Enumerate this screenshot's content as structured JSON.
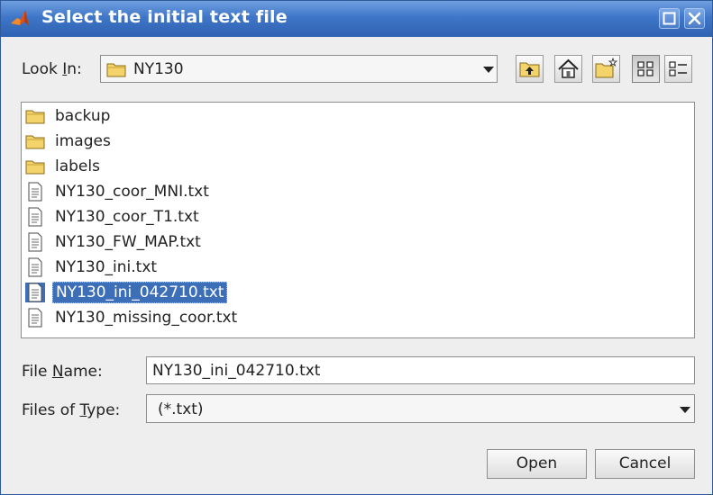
{
  "window": {
    "title": "Select the initial text file"
  },
  "look_in": {
    "label_pre": "Look ",
    "label_key": "I",
    "label_post": "n:",
    "value": "NY130"
  },
  "toolbar": {
    "icons": [
      "up-one-level-icon",
      "home-icon",
      "new-folder-icon",
      "list-view-icon",
      "details-view-icon"
    ],
    "active_view": "list-view-icon"
  },
  "files": [
    {
      "name": "backup",
      "type": "folder",
      "selected": false
    },
    {
      "name": "images",
      "type": "folder",
      "selected": false
    },
    {
      "name": "labels",
      "type": "folder",
      "selected": false
    },
    {
      "name": "NY130_coor_MNI.txt",
      "type": "file",
      "selected": false
    },
    {
      "name": "NY130_coor_T1.txt",
      "type": "file",
      "selected": false
    },
    {
      "name": "NY130_FW_MAP.txt",
      "type": "file",
      "selected": false
    },
    {
      "name": "NY130_ini.txt",
      "type": "file",
      "selected": false
    },
    {
      "name": "NY130_ini_042710.txt",
      "type": "file",
      "selected": true
    },
    {
      "name": "NY130_missing_coor.txt",
      "type": "file",
      "selected": false
    }
  ],
  "file_name": {
    "label_pre": "File ",
    "label_key": "N",
    "label_post": "ame:",
    "value": "NY130_ini_042710.txt"
  },
  "file_type": {
    "label_pre": "Files of ",
    "label_key": "T",
    "label_post": "ype:",
    "value": "(*.txt)"
  },
  "buttons": {
    "open": "Open",
    "cancel": "Cancel"
  },
  "colors": {
    "title_bar": "#3f76c8",
    "selection": "#3d6fb8",
    "folder": "#f3d36a"
  }
}
